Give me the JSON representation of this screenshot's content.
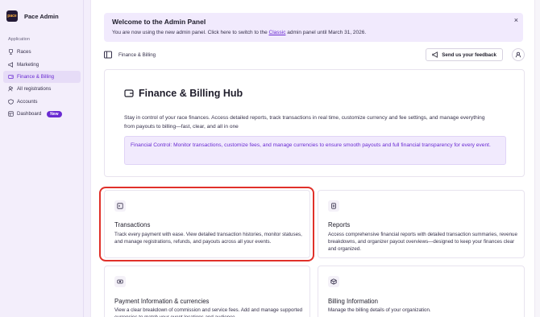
{
  "sidebar": {
    "brand": "Pace Admin",
    "logo_text": "pace",
    "section_label": "Application",
    "items": [
      {
        "label": "Races",
        "icon": "trophy-icon"
      },
      {
        "label": "Marketing",
        "icon": "megaphone-icon"
      },
      {
        "label": "Finance & Billing",
        "icon": "wallet-icon",
        "active": true
      },
      {
        "label": "All registrations",
        "icon": "users-icon"
      },
      {
        "label": "Accounts",
        "icon": "shield-icon"
      },
      {
        "label": "Dashboard",
        "icon": "dashboard-icon",
        "badge": "New"
      }
    ]
  },
  "banner": {
    "title": "Welcome to the Admin Panel",
    "text_before": "You are now using the new admin panel. Click here to switch to the ",
    "link": "Classic",
    "text_after": " admin panel until March 31, 2026.",
    "close": "×"
  },
  "toolbar": {
    "breadcrumb": "Finance & Billing",
    "feedback_label": "Send us your feedback"
  },
  "hub": {
    "title": "Finance & Billing Hub",
    "description": "Stay in control of your race finances. Access detailed reports, track transactions in real time, customize currency and fee settings, and manage everything from payouts to billing—fast, clear, and all in one",
    "callout": "Financial Control: Monitor transactions, customize fees, and manage currencies to ensure smooth payouts and full financial transparency for every event."
  },
  "cards": [
    {
      "title": "Transactions",
      "icon": "terminal-icon",
      "description": "Track every payment with ease. View detailed transaction histories, monitor statuses, and manage registrations, refunds, and payouts across all your events."
    },
    {
      "title": "Reports",
      "icon": "report-icon",
      "description": "Access comprehensive financial reports with detailed transaction summaries, revenue breakdowns, and organizer payout overviews—designed to keep your finances clear and organized."
    },
    {
      "title": "Payment Information & currencies",
      "icon": "banknote-icon",
      "description": "View a clear breakdown of commission and service fees. Add and manage supported currencies to match your event locations and audience."
    },
    {
      "title": "Billing Information",
      "icon": "box-icon",
      "description": "Manage the billing details of your organization."
    }
  ],
  "colors": {
    "accent": "#6a2bd2",
    "highlight": "#e0302a",
    "banner_bg": "#f1eafd"
  }
}
